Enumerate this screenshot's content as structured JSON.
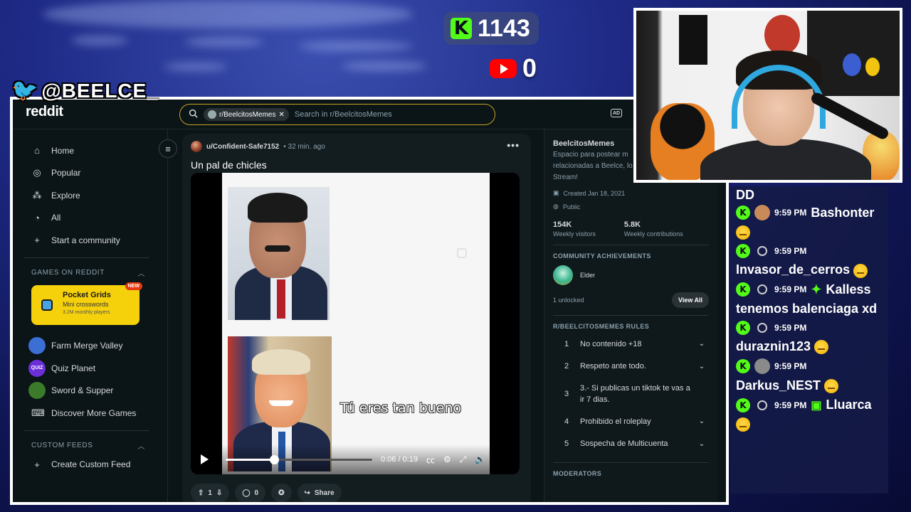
{
  "overlay": {
    "kick_count": "1143",
    "youtube_count": "0",
    "twitter_handle": "@BEELCE_"
  },
  "reddit": {
    "logo": "reddit",
    "search": {
      "chip": "r/BeelcitosMemes",
      "chip_close": "✕",
      "placeholder": "Search in r/BeelcitosMemes"
    },
    "sidebar": {
      "nav": [
        {
          "label": "Home",
          "icon": "home-icon"
        },
        {
          "label": "Popular",
          "icon": "popular-icon"
        },
        {
          "label": "Explore",
          "icon": "explore-icon"
        },
        {
          "label": "All",
          "icon": "all-icon"
        },
        {
          "label": "Start a community",
          "icon": "plus-icon"
        }
      ],
      "games_header": "GAMES ON REDDIT",
      "featured_game": {
        "title": "Pocket Grids",
        "subtitle": "Mini crosswords",
        "meta": "3.2M monthly players",
        "badge": "NEW"
      },
      "games": [
        {
          "label": "Farm Merge Valley",
          "color": "#3b6fd4"
        },
        {
          "label": "Quiz Planet",
          "color": "#6a2fd6",
          "avatar_text": "QUIZ"
        },
        {
          "label": "Sword & Supper",
          "color": "#3a7a2a"
        },
        {
          "label": "Discover More Games",
          "icon": "gamepad-icon"
        }
      ],
      "custom_feeds_header": "CUSTOM FEEDS",
      "create_feed": "Create Custom Feed"
    },
    "post": {
      "user": "u/Confident-Safe7152",
      "time": "• 32 min. ago",
      "title": "Un pal de chicles",
      "caption": "Tú eres tan bueno",
      "watermark": "",
      "time_display": "0:06 / 0:19",
      "progress_fraction": 0.33,
      "votes": "1",
      "comments": "0",
      "share": "Share"
    },
    "community": {
      "name": "BeelcitosMemes",
      "description": "Espacio para postear m relacionadas a Beelce, lo salir en Stream!",
      "created": "Created Jan 18, 2021",
      "visibility": "Public",
      "visitors_value": "154K",
      "visitors_label": "Weekly visitors",
      "contrib_value": "5.8K",
      "contrib_label": "Weekly contributions",
      "achievements_header": "COMMUNITY ACHIEVEMENTS",
      "achievement": "Elder",
      "unlocked": "1 unlocked",
      "view_all": "View All",
      "rules_header": "R/BEELCITOSMEMES RULES",
      "rules": [
        {
          "num": "1",
          "text": "No contenido +18"
        },
        {
          "num": "2",
          "text": "Respeto ante todo."
        },
        {
          "num": "3",
          "text": "3.- Si publicas un tiktok te vas a ir 7 dias."
        },
        {
          "num": "4",
          "text": "Prohibido el roleplay"
        },
        {
          "num": "5",
          "text": "Sospecha de Multicuenta"
        }
      ],
      "moderators_header": "MODERATORS"
    }
  },
  "chat": {
    "top_fragment": "DD",
    "messages": [
      {
        "time": "9:59 PM",
        "user": "Bashonter",
        "message": "",
        "avatar": "photo",
        "color": "#c98a5a"
      },
      {
        "time": "9:59 PM",
        "user": "",
        "message": "Invasor_de_cerros",
        "avatar": "default"
      },
      {
        "time": "9:59 PM",
        "user": "Kalless",
        "message": "tenemos balenciaga xd",
        "avatar": "default",
        "badge": "sparkle"
      },
      {
        "time": "9:59 PM",
        "user": "",
        "message": "duraznin123",
        "avatar": "default"
      },
      {
        "time": "9:59 PM",
        "user": "",
        "message": "Darkus_NEST",
        "avatar": "photo",
        "color": "#8a8a8a"
      },
      {
        "time": "9:59 PM",
        "user": "Lluarca",
        "message": "",
        "avatar": "default",
        "badge": "gift"
      }
    ]
  },
  "colors": {
    "kick_green": "#53fc18",
    "youtube_red": "#ff0000",
    "reddit_bg": "#0b1416",
    "search_border": "#c9a227",
    "game_card": "#f5d10c"
  }
}
